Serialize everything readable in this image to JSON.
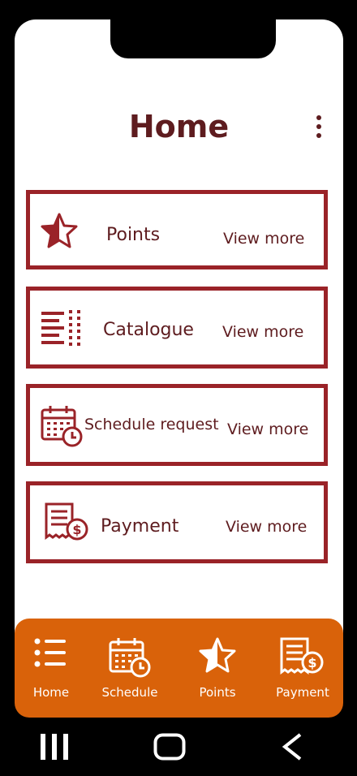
{
  "header": {
    "title": "Home",
    "menu_icon": "more-vertical-icon"
  },
  "cards": [
    {
      "label": "Points",
      "link": "View more",
      "icon": "star-icon"
    },
    {
      "label": "Catalogue",
      "link": "View more",
      "icon": "list-icon"
    },
    {
      "label": "Schedule request",
      "link": "View more",
      "icon": "calendar-clock-icon"
    },
    {
      "label": "Payment",
      "link": "View more",
      "icon": "receipt-dollar-icon"
    }
  ],
  "bottom_nav": [
    {
      "label": "Home",
      "icon": "list-icon"
    },
    {
      "label": "Schedule",
      "icon": "calendar-clock-icon"
    },
    {
      "label": "Points",
      "icon": "star-icon"
    },
    {
      "label": "Payment",
      "icon": "receipt-dollar-icon"
    }
  ],
  "system_nav": {
    "recents": "recents-icon",
    "home": "home-button-icon",
    "back": "back-icon"
  },
  "colors": {
    "primary": "#5e1c1f",
    "card_border": "#9a2328",
    "nav_bg": "#d9620a"
  }
}
